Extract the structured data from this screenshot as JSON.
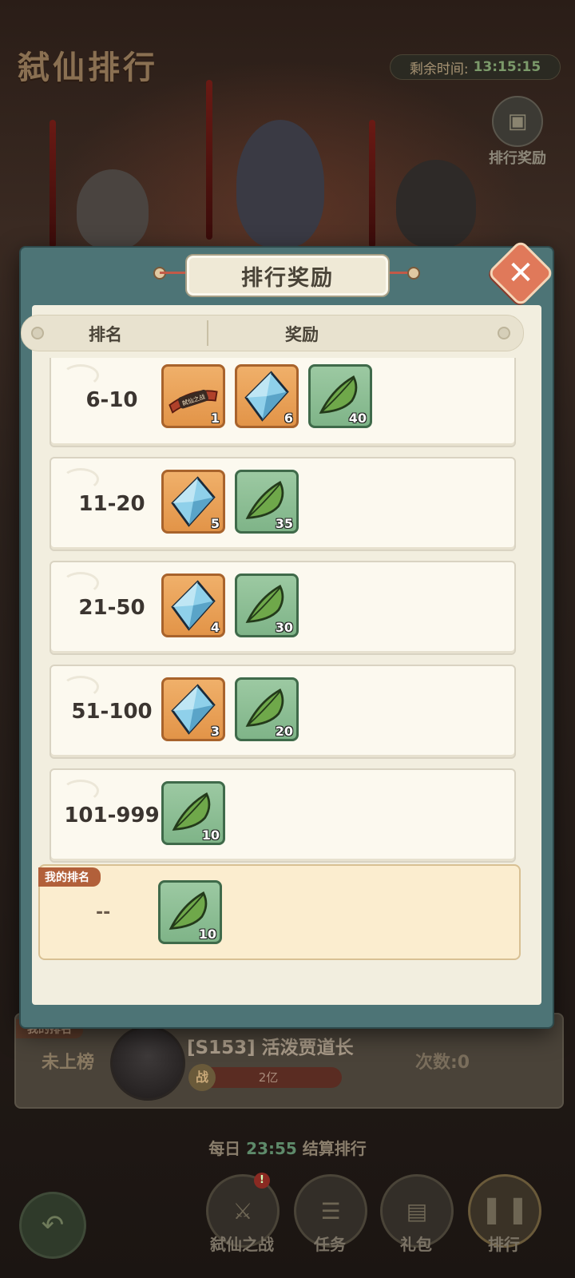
{
  "background": {
    "title": "弑仙排行",
    "timer_label": "剩余时间:",
    "timer_value": "13:15:15",
    "reward_button_label": "排行奖励",
    "my_rank_tag": "我的排名",
    "my_rank_value": "未上榜",
    "player_name": "[S153] 活泼贾道长",
    "power_badge": "战",
    "power_value": "2亿",
    "attempts": "次数:0",
    "daily_prefix": "每日",
    "daily_time": "23:55",
    "daily_suffix": "结算排行"
  },
  "bottom_nav": [
    {
      "label": "弑仙之战",
      "icon": "crossed-swords-icon",
      "badge": "!"
    },
    {
      "label": "任务",
      "icon": "scroll-icon"
    },
    {
      "label": "礼包",
      "icon": "gift-chest-icon"
    },
    {
      "label": "排行",
      "icon": "ranking-bars-icon"
    }
  ],
  "modal": {
    "title": "排行奖励",
    "col_rank": "排名",
    "col_reward": "奖励",
    "rows": [
      {
        "rank": "6-10",
        "items": [
          {
            "type": "title-banner",
            "color": "orange",
            "qty": "1",
            "text": "弑仙之战"
          },
          {
            "type": "crystal",
            "color": "orange",
            "qty": "6"
          },
          {
            "type": "herb",
            "color": "green",
            "qty": "40"
          }
        ]
      },
      {
        "rank": "11-20",
        "items": [
          {
            "type": "crystal",
            "color": "orange",
            "qty": "5"
          },
          {
            "type": "herb",
            "color": "green",
            "qty": "35"
          }
        ]
      },
      {
        "rank": "21-50",
        "items": [
          {
            "type": "crystal",
            "color": "orange",
            "qty": "4"
          },
          {
            "type": "herb",
            "color": "green",
            "qty": "30"
          }
        ]
      },
      {
        "rank": "51-100",
        "items": [
          {
            "type": "crystal",
            "color": "orange",
            "qty": "3"
          },
          {
            "type": "herb",
            "color": "green",
            "qty": "20"
          }
        ]
      },
      {
        "rank": "101-999",
        "items": [
          {
            "type": "herb",
            "color": "green",
            "qty": "10"
          }
        ]
      }
    ],
    "my_rank": {
      "tag": "我的排名",
      "value": "--",
      "items": [
        {
          "type": "herb",
          "color": "green",
          "qty": "10"
        }
      ]
    }
  }
}
